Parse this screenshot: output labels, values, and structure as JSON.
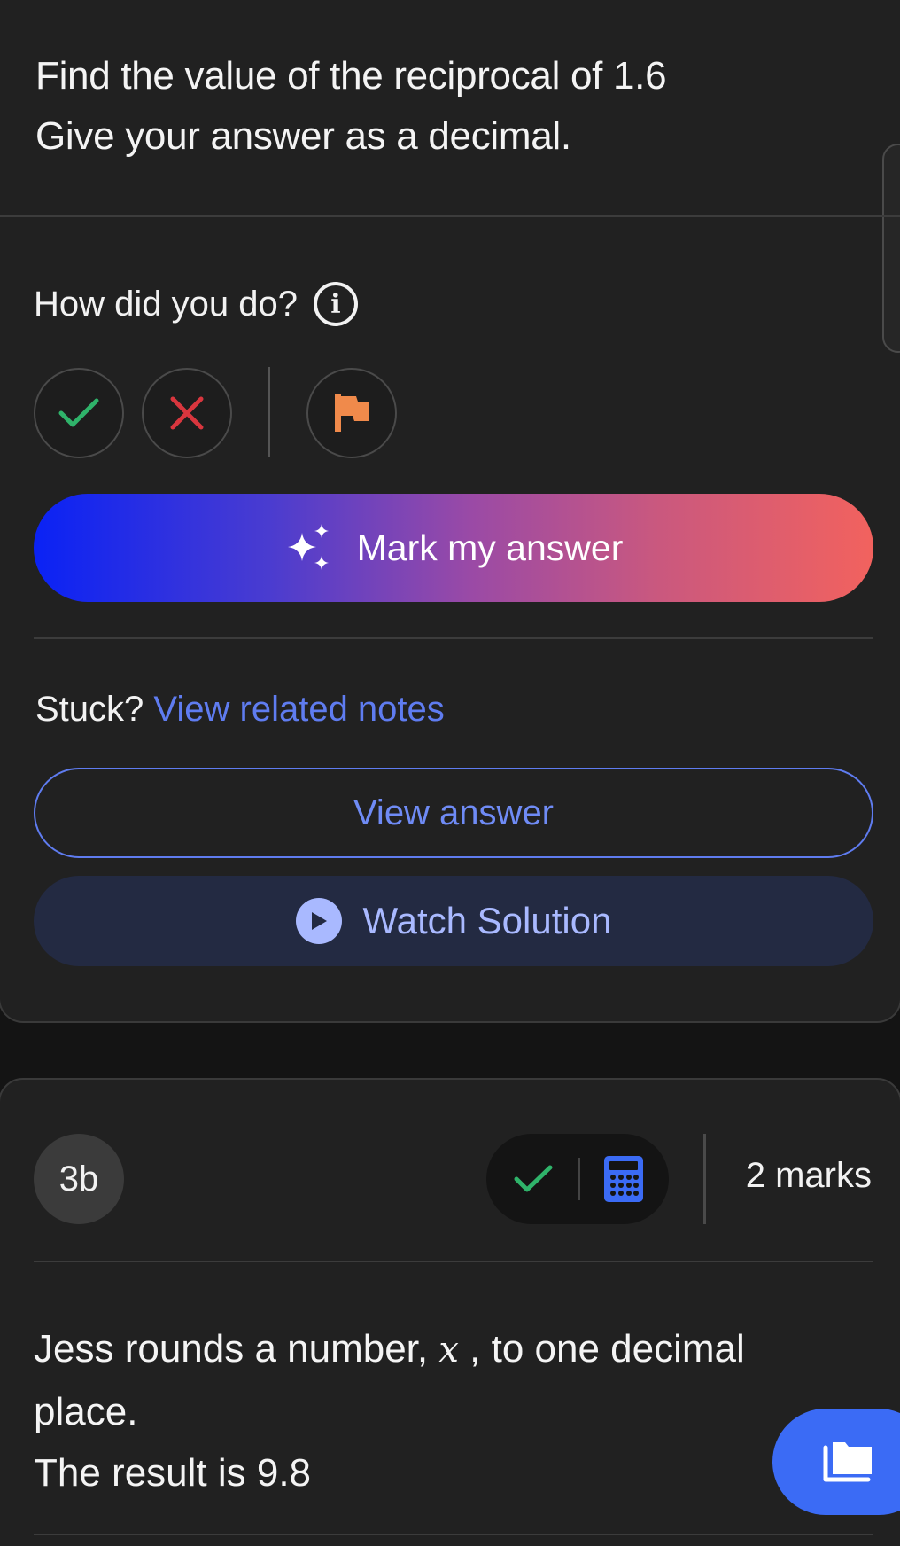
{
  "question_a": {
    "line1": "Find the value of the reciprocal of 1.6",
    "line2": "Give your answer as a decimal."
  },
  "feedback": {
    "label": "How did you do?",
    "info_icon": "info-icon",
    "correct_icon": "check-icon",
    "incorrect_icon": "cross-icon",
    "flag_icon": "flag-icon"
  },
  "mark_button": {
    "label": "Mark my answer",
    "icon": "sparkles-icon"
  },
  "help": {
    "stuck_label": "Stuck?",
    "notes_link": "View related notes",
    "view_answer_label": "View answer",
    "watch_label": "Watch Solution",
    "watch_icon": "play-icon"
  },
  "question_b": {
    "number": "3b",
    "status_icon": "check-icon",
    "calculator_icon": "calculator-icon",
    "marks": "2 marks",
    "text_before_var": "Jess rounds a number, ",
    "variable": "x",
    "text_after_var": " , to one decimal place.",
    "line2": "The result is 9.8"
  },
  "fab": {
    "icon": "folder-icon"
  },
  "colors": {
    "background": "#141414",
    "card": "#212121",
    "link_blue": "#5f7cf0",
    "gradient_start": "#0a22f5",
    "gradient_end": "#f2625e",
    "correct_green": "#2fb36a",
    "incorrect_red": "#d9363e",
    "flag_orange": "#f08a4b",
    "fab_blue": "#3b6bf5"
  }
}
